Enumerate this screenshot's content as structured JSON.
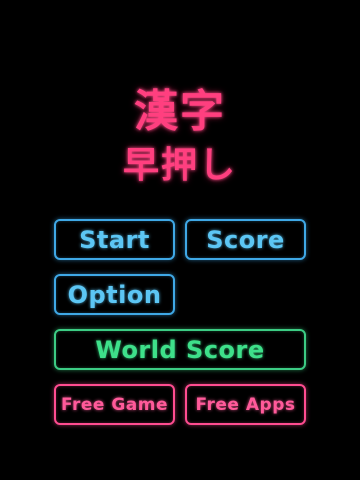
{
  "title": {
    "main": "漢字",
    "sub": "早押し"
  },
  "menu": {
    "start_label": "Start",
    "score_label": "Score",
    "option_label": "Option",
    "world_score_label": "World Score",
    "free_game_label": "Free Game",
    "free_apps_label": "Free Apps"
  },
  "colors": {
    "background": "#000000",
    "title": "#ff3f7f",
    "blue_neon": "#5cc6f4",
    "green_neon": "#3ee08a",
    "pink_neon": "#ff5a9a"
  }
}
